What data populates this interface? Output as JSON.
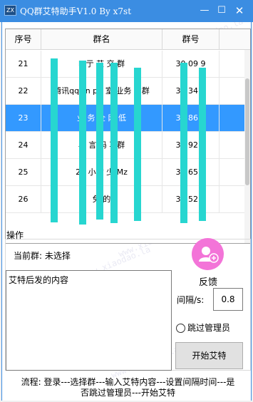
{
  "window": {
    "icon_text": "ZX",
    "title": "QQ群艾特助手V1.0 By x7st",
    "minimize_glyph": "—",
    "maximize_glyph": "☐",
    "close_glyph": "✕"
  },
  "table": {
    "columns": [
      "序号",
      "群名",
      "群号"
    ],
    "rows": [
      {
        "index": "21",
        "name": "K  亍  艾  交  群",
        "number": "30    09    9"
      },
      {
        "index": "22",
        "name": "腾讯qq&n  p  :  室  业务  刷群",
        "number": "31    34    1"
      },
      {
        "index": "23",
        "name": "业  务  全  网  低",
        "number": "33    86    4",
        "selected": true
      },
      {
        "index": "24",
        "name": "易  言  码  享群",
        "number": "36    92    4"
      },
      {
        "index": "25",
        "name": "24  小时  少  Mz",
        "number": "36    65    4"
      },
      {
        "index": "26",
        "name": "免  的",
        "number": "36    52    7"
      }
    ]
  },
  "panel": {
    "label": "操作",
    "current_group": "当前群: 未选择",
    "content_text": "艾特后发的内容",
    "feedback_label": "反馈",
    "interval_label": "间隔/s:",
    "interval_value": "0.8",
    "skip_admin_label": "跳过管理员",
    "skip_admin_checked": false,
    "start_button": "开始艾特"
  },
  "footer": {
    "process_line1": "流程: 登录---选择群---输入艾特内容---设置间隔时间---是",
    "process_line2": "否跳过管理员---开始艾特"
  },
  "watermark_text": "www.xiaodao.la",
  "colors": {
    "titlebar": "#3b8de2",
    "selection": "#3399ff",
    "avatar": "#f374d8",
    "redaction": "#27d6d0"
  }
}
